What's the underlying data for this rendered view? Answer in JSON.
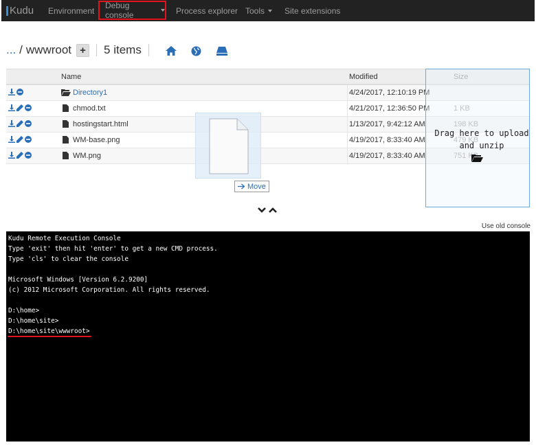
{
  "navbar": {
    "brand": "Kudu",
    "items": [
      {
        "label": "Environment"
      },
      {
        "label": "Debug console"
      },
      {
        "label": "Process explorer"
      },
      {
        "label": "Tools"
      },
      {
        "label": "Site extensions"
      }
    ]
  },
  "breadcrumb": {
    "ellipsis": "...",
    "separator": "/",
    "current": "wwwroot",
    "add_label": "+",
    "items_count": "5 items"
  },
  "table": {
    "headers": {
      "name": "Name",
      "modified": "Modified",
      "size": "Size"
    },
    "rows": [
      {
        "name": "Directory1",
        "modified": "4/24/2017, 12:10:19 PM",
        "size": ""
      },
      {
        "name": "chmod.txt",
        "modified": "4/21/2017, 12:36:50 PM",
        "size": "1 KB"
      },
      {
        "name": "hostingstart.html",
        "modified": "1/13/2017, 9:42:12 AM",
        "size": "198 KB"
      },
      {
        "name": "WM-base.png",
        "modified": "4/19/2017, 8:33:40 AM",
        "size": "479 KB"
      },
      {
        "name": "WM.png",
        "modified": "4/19/2017, 8:33:40 AM",
        "size": "751 KB"
      }
    ]
  },
  "dropzone": {
    "text": "Drag here to upload and unzip"
  },
  "drag": {
    "move_label": "Move"
  },
  "use_old_console": "Use old console",
  "console": {
    "lines": [
      "Kudu Remote Execution Console",
      "Type 'exit' then hit 'enter' to get a new CMD process.",
      "Type 'cls' to clear the console",
      "",
      "Microsoft Windows [Version 6.2.9200]",
      "(c) 2012 Microsoft Corporation. All rights reserved.",
      "",
      "D:\\home>",
      "D:\\home\\site>",
      "D:\\home\\site\\wwwroot>"
    ]
  },
  "colors": {
    "accent": "#2a6eb8",
    "highlight": "#e3131b",
    "navbar": "#222222"
  }
}
